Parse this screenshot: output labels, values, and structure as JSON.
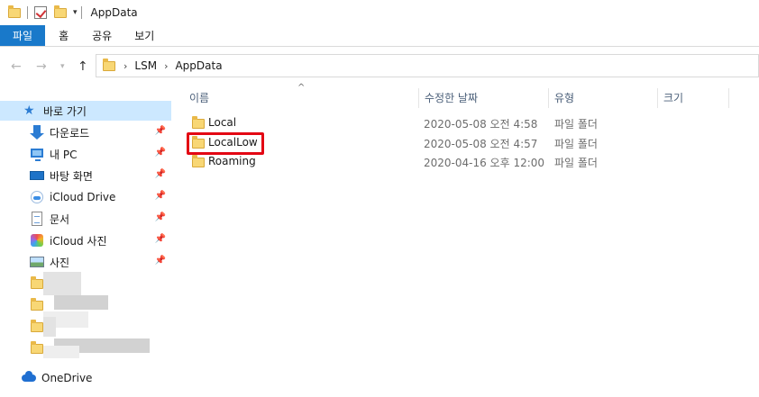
{
  "window": {
    "title": "AppData"
  },
  "ribbon": {
    "tabs": [
      "파일",
      "홈",
      "공유",
      "보기"
    ]
  },
  "address": {
    "segments": [
      "LSM",
      "AppData"
    ]
  },
  "sidebar": {
    "quick_access": "바로 가기",
    "items": [
      {
        "label": "다운로드",
        "icon": "download-icon"
      },
      {
        "label": "내 PC",
        "icon": "computer-icon"
      },
      {
        "label": "바탕 화면",
        "icon": "desktop-icon"
      },
      {
        "label": "iCloud Drive",
        "icon": "icloud-drive-icon"
      },
      {
        "label": "문서",
        "icon": "documents-icon"
      },
      {
        "label": "iCloud 사진",
        "icon": "icloud-photos-icon"
      },
      {
        "label": "사진",
        "icon": "pictures-icon"
      }
    ],
    "onedrive": "OneDrive"
  },
  "columns": {
    "name": "이름",
    "date": "수정한 날짜",
    "type": "유형",
    "size": "크기"
  },
  "files": [
    {
      "name": "Local",
      "date": "2020-05-08 오전 4:58",
      "type": "파일 폴더"
    },
    {
      "name": "LocalLow",
      "date": "2020-05-08 오전 4:57",
      "type": "파일 폴더"
    },
    {
      "name": "Roaming",
      "date": "2020-04-16 오후 12:00",
      "type": "파일 폴더"
    }
  ],
  "colors": {
    "accent": "#1979ca",
    "selection": "#cce8ff",
    "highlight_box": "#e30613",
    "folder": "#f8d775"
  }
}
